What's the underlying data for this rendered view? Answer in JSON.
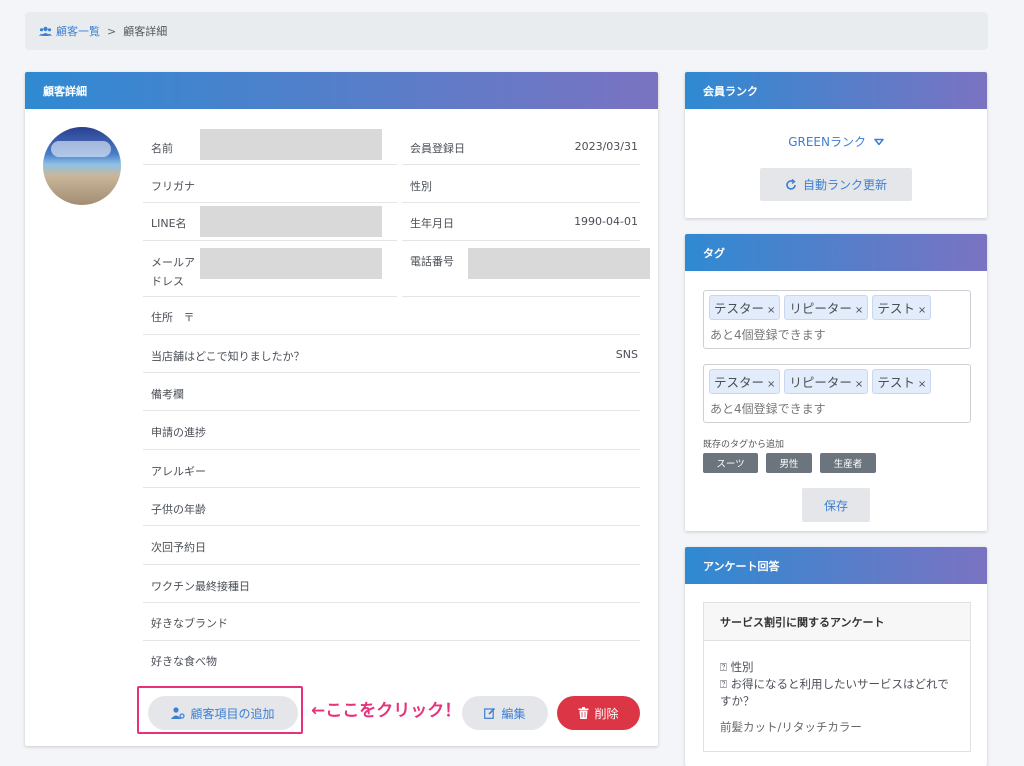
{
  "breadcrumb": {
    "parent": "顧客一覧",
    "separator": ">",
    "current": "顧客詳細"
  },
  "customer_card": {
    "title": "顧客詳細",
    "fields": {
      "name_label": "名前",
      "register_label": "会員登録日",
      "register_value": "2023/03/31",
      "furigana_label": "フリガナ",
      "gender_label": "性別",
      "line_label": "LINE名",
      "birthday_label": "生年月日",
      "birthday_value": "1990-04-01",
      "mail_label_1": "メールア",
      "mail_label_2": "ドレス",
      "phone_label": "電話番号",
      "address_label": "住所",
      "address_value": "〒",
      "source_label": "当店舗はどこで知りましたか？",
      "source_value": "SNS",
      "note_label": "備考欄",
      "progress_label": "申請の進捗",
      "allergy_label": "アレルギー",
      "child_age_label": "子供の年齢",
      "next_visit_label": "次回予約日",
      "vaccine_label": "ワクチン最終接種日",
      "brand_label": "好きなブランド",
      "food_label": "好きな食べ物"
    },
    "buttons": {
      "add_field": "顧客項目の追加",
      "edit": "編集",
      "delete": "削除"
    },
    "annotation": "←ここをクリック！"
  },
  "rank_card": {
    "title": "会員ランク",
    "selected_rank": "GREENランク",
    "refresh_button": "自動ランク更新"
  },
  "tag_card": {
    "title": "タグ",
    "box1": {
      "chips": [
        "テスター",
        "リピーター",
        "テスト"
      ],
      "placeholder": "あと4個登録できます"
    },
    "box2": {
      "chips": [
        "テスター",
        "リピーター",
        "テスト"
      ],
      "placeholder": "あと4個登録できます"
    },
    "existing_label": "既存のタグから追加",
    "existing_tags": [
      "スーツ",
      "男性",
      "生産者"
    ],
    "save_button": "保存"
  },
  "survey_card": {
    "title": "アンケート回答",
    "survey_title": "サービス割引に関するアンケート",
    "q1": "性別",
    "q2": "お得になると利用したいサービスはどれですか？",
    "answer": "前髪カット/リタッチカラー"
  },
  "colors": {
    "accent": "#3d7fd1",
    "header_start": "#2f8ad2",
    "header_end": "#7a73c2",
    "danger": "#dc3545",
    "highlight": "#e8317a"
  }
}
